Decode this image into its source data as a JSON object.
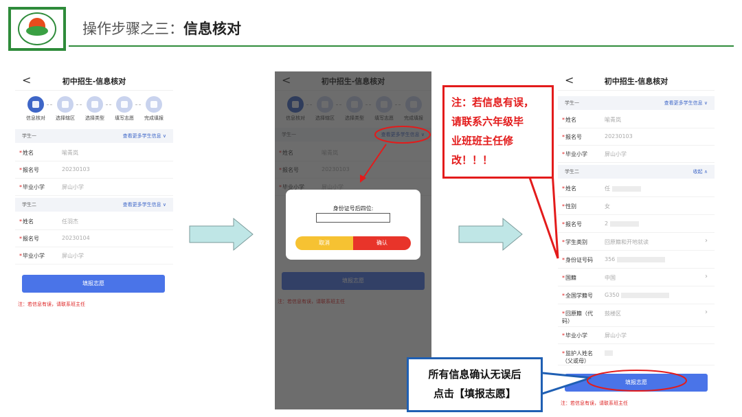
{
  "header": {
    "title_prefix": "操作步骤之三：",
    "title_bold": "信息核对"
  },
  "phone": {
    "back": "<",
    "title": "初中招生-信息核对",
    "steps": [
      "信息核对",
      "选择辖区",
      "选择类型",
      "填写志愿",
      "完成填报"
    ],
    "student1": "学生一",
    "student2": "学生二",
    "more": "查看更多学生信息 ∨",
    "collapse": "收起 ∧",
    "submit": "填报志愿",
    "note": "注：若信息有误，请联系班主任",
    "s1": [
      {
        "k": "姓名",
        "v": "喻青岚"
      },
      {
        "k": "报名号",
        "v": "20230103"
      },
      {
        "k": "毕业小学",
        "v": "屏山小学"
      }
    ],
    "s2": [
      {
        "k": "姓名",
        "v": "任羽杰"
      },
      {
        "k": "报名号",
        "v": "20230104"
      },
      {
        "k": "毕业小学",
        "v": "屏山小学"
      }
    ]
  },
  "modal": {
    "label": "身份证号后四位:",
    "cancel": "取消",
    "confirm": "确认"
  },
  "right": {
    "rows": [
      {
        "k": "姓名",
        "v": "任"
      },
      {
        "k": "性别",
        "v": "女"
      },
      {
        "k": "报名号",
        "v": "2"
      },
      {
        "k": "学生类别",
        "v": "回原籍和开地就读"
      },
      {
        "k": "身份证号码",
        "v": "356"
      },
      {
        "k": "国籍",
        "v": "中国"
      },
      {
        "k": "全国学籍号",
        "v": "G350"
      },
      {
        "k": "回原籍（代码）",
        "v": "鼓楼区"
      },
      {
        "k": "毕业小学",
        "v": "屏山小学"
      },
      {
        "k": "监护人姓名（父或母）",
        "v": ""
      }
    ]
  },
  "callouts": {
    "red": [
      "注：若信息有误，",
      "请联系六年级毕",
      "业班班主任修",
      "改！！！"
    ],
    "blue": [
      "所有信息确认无误后",
      "点击【填报志愿】"
    ]
  },
  "colors": {
    "accent": "#4a74e8",
    "alert": "#e31b1b",
    "brand": "#2e8b3a"
  }
}
